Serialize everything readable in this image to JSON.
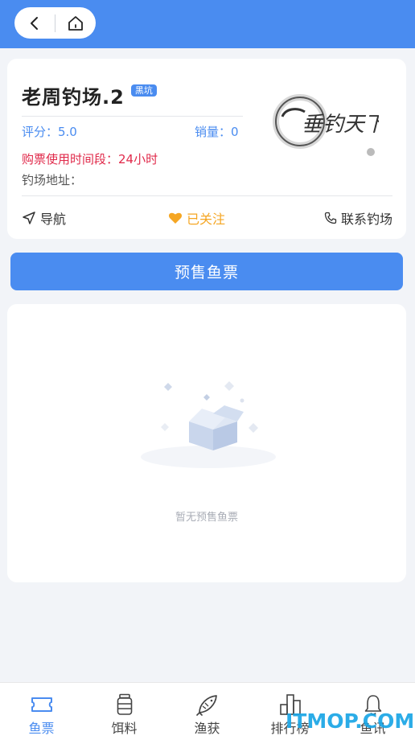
{
  "nav": {
    "back_icon": "chevron-left-icon",
    "home_icon": "home-icon"
  },
  "venue": {
    "name": "老周钓场.2",
    "tag": "黑坑",
    "score": "评分：5.0",
    "sales": "销量：0",
    "hours": "购票使用时间段：24小时",
    "address": "钓场地址：",
    "logo_text": "垂钓天下"
  },
  "actions": {
    "navigate": "导航",
    "followed": "已关注",
    "contact": "联系钓场"
  },
  "buy_button": "预售鱼票",
  "empty_state": {
    "text": "暂无预售鱼票"
  },
  "tabs": [
    {
      "label": "鱼票",
      "icon": "ticket-icon",
      "active": true
    },
    {
      "label": "饵料",
      "icon": "bait-jar-icon",
      "active": false
    },
    {
      "label": "渔获",
      "icon": "fish-icon",
      "active": false
    },
    {
      "label": "排行榜",
      "icon": "ranking-icon",
      "active": false
    },
    {
      "label": "鱼讯",
      "icon": "bell-icon",
      "active": false
    }
  ],
  "watermark": "ITMOP.COM",
  "colors": {
    "primary": "#4a8cf0",
    "hours_red": "#e0294a",
    "follow_orange": "#f5a623",
    "background": "#f2f4f8"
  }
}
